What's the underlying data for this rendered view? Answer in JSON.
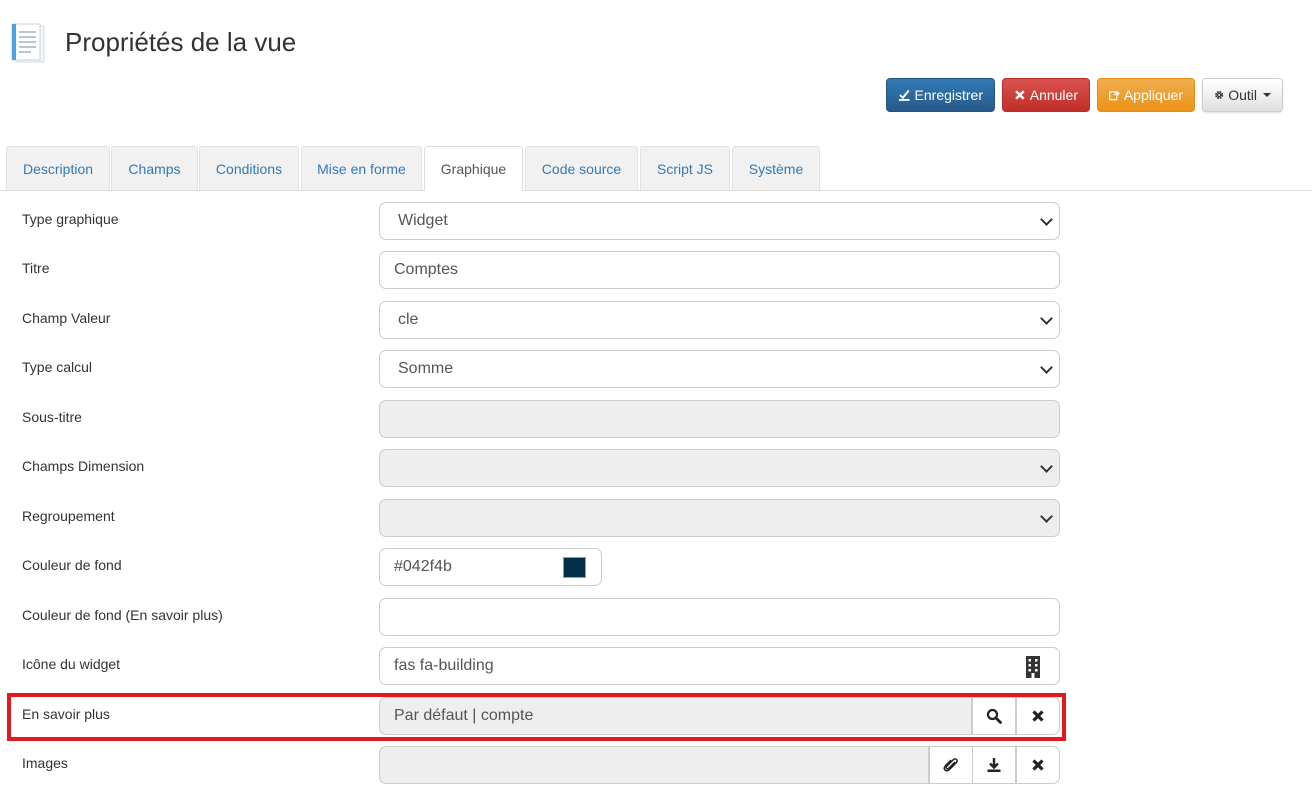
{
  "header": {
    "title": "Propriétés de la vue",
    "icon": "document-list-icon"
  },
  "toolbar": {
    "save_label": "Enregistrer",
    "cancel_label": "Annuler",
    "apply_label": "Appliquer",
    "tool_label": "Outil"
  },
  "tabs": [
    {
      "label": "Description"
    },
    {
      "label": "Champs"
    },
    {
      "label": "Conditions"
    },
    {
      "label": "Mise en forme"
    },
    {
      "label": "Graphique",
      "active": true
    },
    {
      "label": "Code source"
    },
    {
      "label": "Script JS"
    },
    {
      "label": "Système"
    }
  ],
  "form": {
    "type_graphique": {
      "label": "Type graphique",
      "value": "Widget"
    },
    "titre": {
      "label": "Titre",
      "value": "Comptes"
    },
    "champ_valeur": {
      "label": "Champ Valeur",
      "value": "cle"
    },
    "type_calcul": {
      "label": "Type calcul",
      "value": "Somme"
    },
    "sous_titre": {
      "label": "Sous-titre",
      "value": ""
    },
    "champs_dimension": {
      "label": "Champs Dimension",
      "value": ""
    },
    "regroupement": {
      "label": "Regroupement",
      "value": ""
    },
    "couleur_fond": {
      "label": "Couleur de fond",
      "value": "#042f4b",
      "swatch": "#042f4b"
    },
    "couleur_fond_plus": {
      "label": "Couleur de fond (En savoir plus)",
      "value": ""
    },
    "icone_widget": {
      "label": "Icône du widget",
      "value": "fas fa-building",
      "icon": "building-icon"
    },
    "en_savoir_plus": {
      "label": "En savoir plus",
      "value": "Par défaut | compte"
    },
    "images": {
      "label": "Images",
      "value": ""
    }
  },
  "colors": {
    "highlight": "#e3191f",
    "primary": "#337ab7",
    "danger": "#d9534f",
    "warning": "#f0ad4e"
  }
}
